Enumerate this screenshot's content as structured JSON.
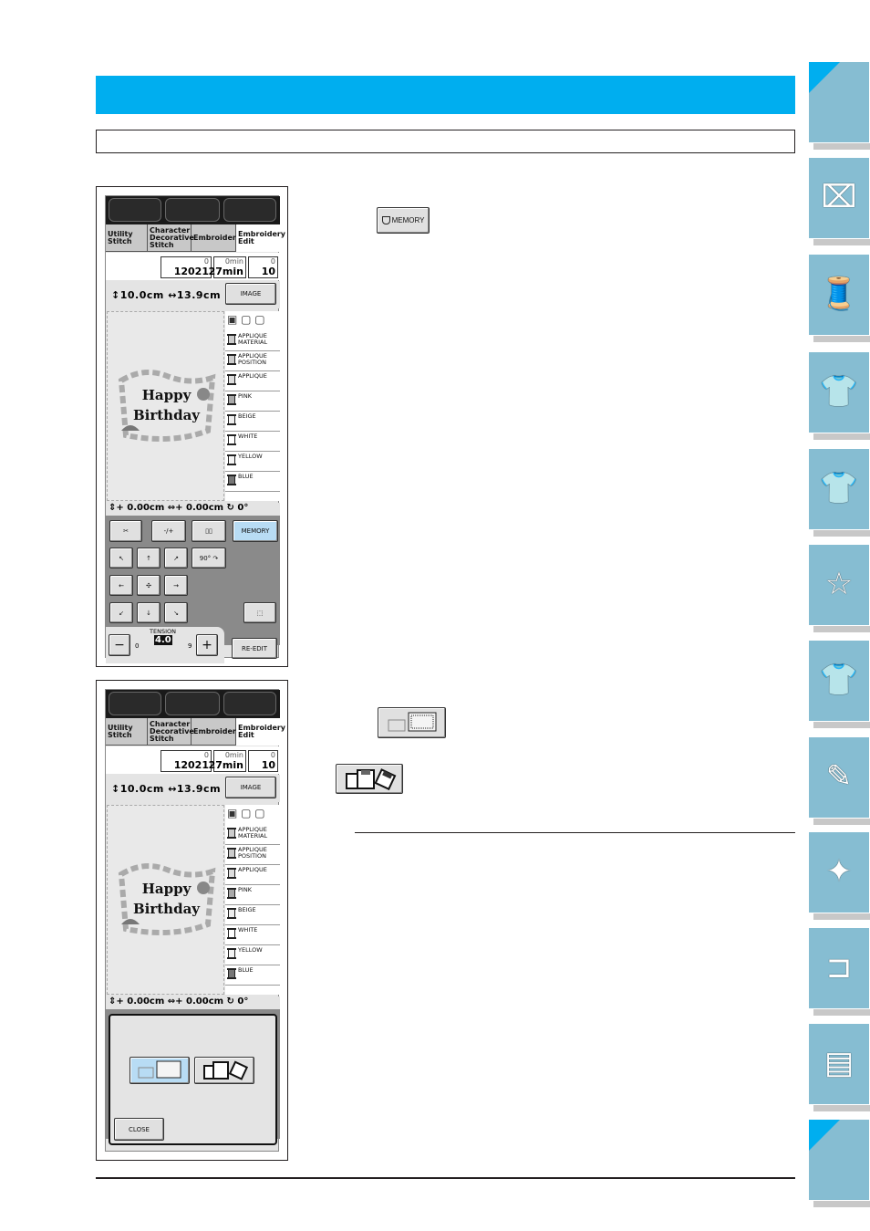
{
  "page": {
    "accent_color": "#00aeef",
    "side_tab_color": "#86bdd2",
    "header_title": "",
    "subheader": ""
  },
  "inline_buttons": {
    "memory": {
      "label": "MEMORY",
      "icon": "pocket-memory-icon"
    },
    "machine_memory": {
      "icon": "machine-pocket-icon"
    },
    "floppy": {
      "icon": "floppy-disk-icon"
    }
  },
  "side_tabs": [
    {
      "name": "blank-top",
      "icon": ""
    },
    {
      "name": "sewing-machine-setup",
      "icon": "sewing-machine-icon"
    },
    {
      "name": "supplies",
      "icon": "thread-spool-icon"
    },
    {
      "name": "utility-stitch",
      "icon": "shirt-stitch-icon"
    },
    {
      "name": "character-decorative",
      "icon": "shirt-abc-icon"
    },
    {
      "name": "embroidery",
      "icon": "embroidery-frame-icon"
    },
    {
      "name": "embroidery-edit",
      "icon": "shirt-edit-icon"
    },
    {
      "name": "my-custom-stitch",
      "icon": "shirt-pen-icon"
    },
    {
      "name": "maintenance",
      "icon": "machine-brush-icon"
    },
    {
      "name": "troubleshooting",
      "icon": "machine-icon"
    },
    {
      "name": "appendix",
      "icon": "documents-icon"
    },
    {
      "name": "blank-bottom",
      "icon": ""
    }
  ],
  "screen": {
    "tabs": [
      "Utility Stitch",
      "Character Decorative Stitch",
      "Embroidery",
      "Embroidery Edit"
    ],
    "stitch_count_top": "0",
    "stitch_count_total": "12021",
    "time_top": "0min",
    "time_total": "27min",
    "color_top": "0",
    "color_total": "10",
    "height": "10.0cm",
    "width": "13.9cm",
    "image_label": "IMAGE",
    "design_text_1": "Happy",
    "design_text_2": "Birthday",
    "colors": [
      "APPLIQUE MATERIAL",
      "APPLIQUE POSITION",
      "APPLIQUE",
      "PINK",
      "BEIGE",
      "WHITE",
      "YELLOW",
      "BLUE"
    ],
    "offset_y": "0.00cm",
    "offset_x": "0.00cm",
    "angle": "0°",
    "memory_label": "MEMORY",
    "rotate_label": "90°",
    "needle_label": "-/+",
    "tension_label": "TENSION",
    "tension_value": "4.0",
    "tension_min": "0",
    "tension_max": "9",
    "reedit_label": "RE-EDIT",
    "close_label": "CLOSE"
  }
}
